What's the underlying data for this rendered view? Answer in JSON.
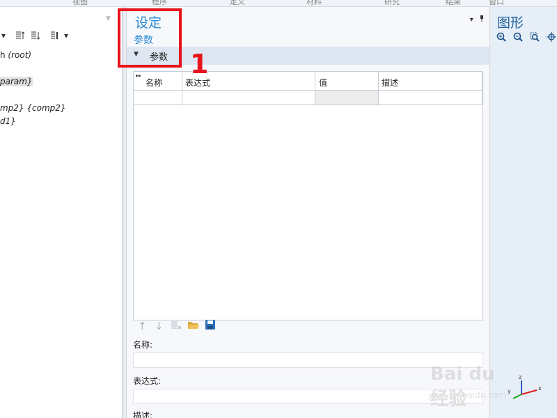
{
  "top_strip": {
    "fragments": [
      "视图",
      "程序",
      "定义",
      "材料",
      "研究",
      "结果",
      "窗口"
    ]
  },
  "model_tree": {
    "collapse_icon": "chevron-down-icon",
    "toolbar_icons": [
      "expand-dropdown-icon",
      "sort-up-icon",
      "sort-down-icon",
      "list-options-icon",
      "more-dropdown-icon"
    ],
    "items": [
      {
        "prefix": "h ",
        "italic": "(root)",
        "highlighted": false
      },
      {
        "prefix": "",
        "italic": "param}",
        "highlighted": true
      },
      {
        "prefix": "",
        "italic": "mp2} {comp2}",
        "highlighted": false
      },
      {
        "prefix": "",
        "italic": "d1}",
        "highlighted": false
      }
    ]
  },
  "settings": {
    "title": "设定",
    "subtitle": "参数",
    "section_label": "参数",
    "controls": [
      "▾",
      "▮"
    ],
    "table": {
      "columns": [
        "名称",
        "表达式",
        "值",
        "描述"
      ],
      "rows": [
        {
          "name": "",
          "expression": "",
          "value": "",
          "description": ""
        }
      ]
    },
    "table_toolbar": [
      "move-up-icon",
      "move-down-icon",
      "delete-rows-icon",
      "open-folder-icon",
      "save-icon"
    ],
    "fields": {
      "name_label": "名称:",
      "name_value": "",
      "expression_label": "表达式:",
      "expression_value": "",
      "description_label": "描述:"
    }
  },
  "annotation": {
    "number": "1",
    "color": "#e8141b"
  },
  "graphics": {
    "title": "图形",
    "toolbar_icons": [
      "zoom-in-icon",
      "zoom-out-icon",
      "zoom-box-icon",
      "zoom-extents-icon"
    ],
    "axes": {
      "x": "x",
      "y": "y",
      "z": "z"
    }
  },
  "watermark": {
    "main": "Bai du 经验",
    "sub": "jingyan.baidu.com"
  },
  "colors": {
    "accent": "#2a8ad4",
    "section_bg": "#dde6f1",
    "graphics_bg": "#e6eef8"
  }
}
